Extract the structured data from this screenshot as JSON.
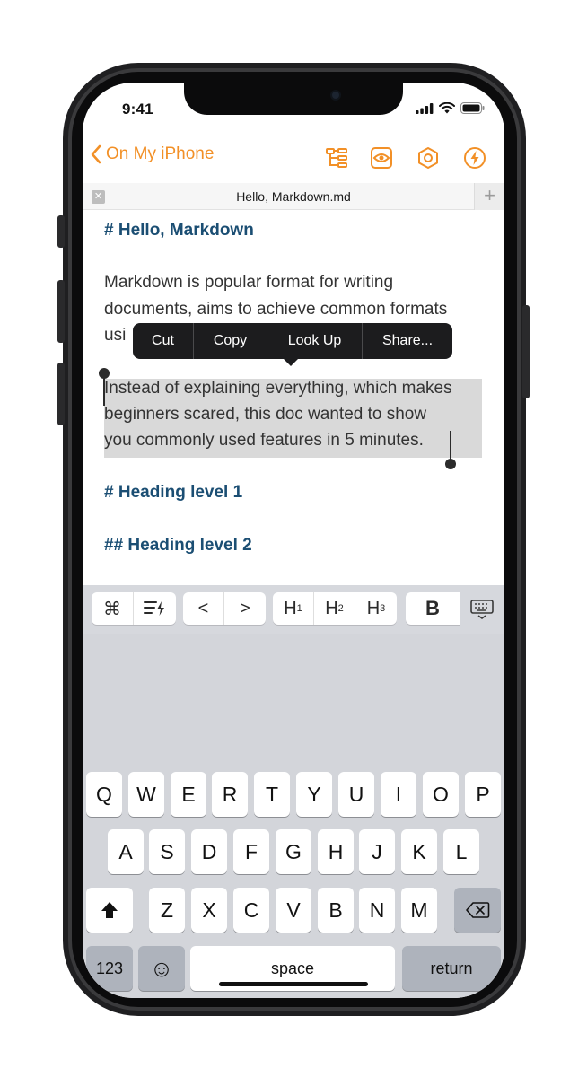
{
  "status": {
    "time": "9:41"
  },
  "nav": {
    "back_label": "On My iPhone"
  },
  "tab": {
    "title": "Hello, Markdown.md",
    "close_glyph": "✕",
    "add_glyph": "+"
  },
  "doc": {
    "heading1": "# Hello, Markdown",
    "para1_line1": "Markdown is popular format for writing",
    "para1_line2": "documents, aims to achieve common formats",
    "para1_line3_visible": "usi",
    "para2_line1": "Instead of explaining everything, which makes",
    "para2_line2": "beginners scared, this doc wanted to show",
    "para2_line3": "you commonly used features in 5 minutes.",
    "heading2": "# Heading level 1",
    "heading3": "## Heading level 2"
  },
  "context_menu": {
    "items": [
      "Cut",
      "Copy",
      "Look Up",
      "Share..."
    ]
  },
  "toolbar": {
    "cmd": "⌘",
    "prev": "<",
    "next": ">",
    "h1": "H",
    "h1_sub": "1",
    "h2": "H",
    "h2_sub": "2",
    "h3": "H",
    "h3_sub": "3",
    "bold": "B"
  },
  "keyboard": {
    "row1": [
      "Q",
      "W",
      "E",
      "R",
      "T",
      "Y",
      "U",
      "I",
      "O",
      "P"
    ],
    "row2": [
      "A",
      "S",
      "D",
      "F",
      "G",
      "H",
      "J",
      "K",
      "L"
    ],
    "row3": [
      "Z",
      "X",
      "C",
      "V",
      "B",
      "N",
      "M"
    ],
    "numbers_label": "123",
    "space_label": "space",
    "return_label": "return",
    "emoji": "☺"
  },
  "colors": {
    "accent": "#f29027",
    "heading": "#1b4e73",
    "selection": "#d9d9d9"
  }
}
